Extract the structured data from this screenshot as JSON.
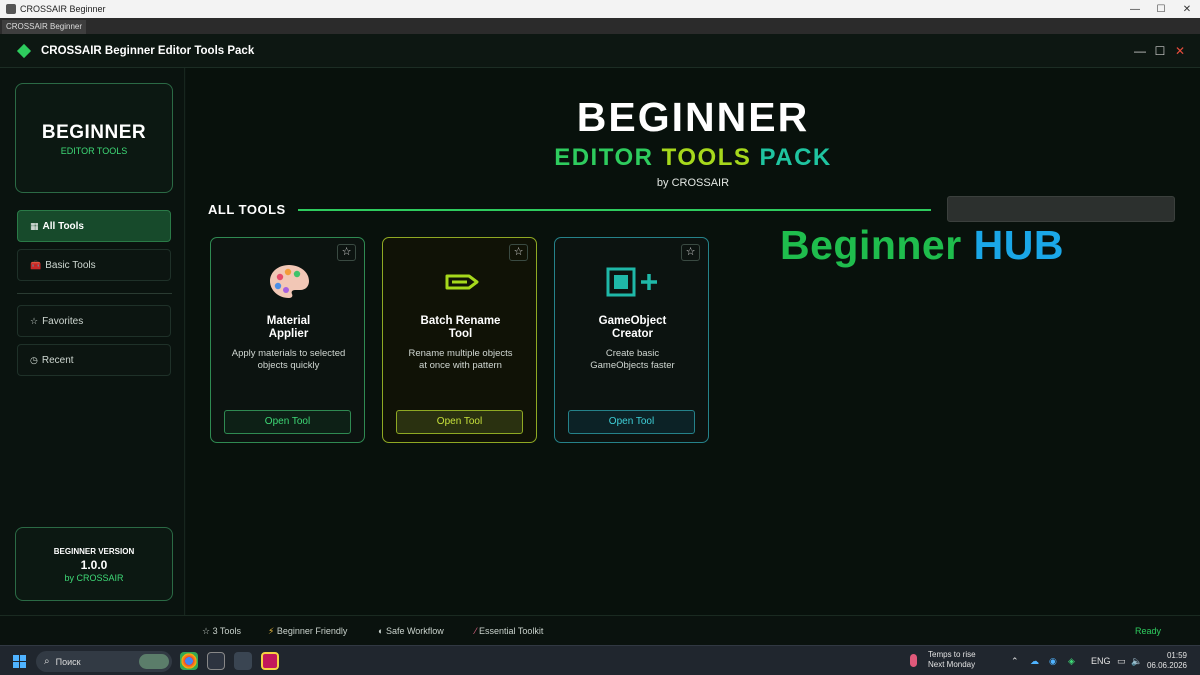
{
  "os_window": {
    "title": "CROSSAIR Beginner",
    "controls": [
      "—",
      "☐",
      "✕"
    ]
  },
  "tab": {
    "label": "CROSSAIR Beginner"
  },
  "app": {
    "title": "CROSSAIR Beginner Editor Tools Pack",
    "brand_color": "#2ecc5e"
  },
  "sidebar": {
    "logo": {
      "title": "BEGINNER",
      "subtitle": "EDITOR TOOLS"
    },
    "items": [
      {
        "icon": "▦",
        "label": "All Tools",
        "active": true
      },
      {
        "icon": "🧰",
        "label": "Basic Tools",
        "active": false
      },
      {
        "icon": "☆",
        "label": "Favorites",
        "active": false
      },
      {
        "icon": "◷",
        "label": "Recent",
        "active": false
      }
    ],
    "version": {
      "label": "BEGINNER VERSION",
      "number": "1.0.0",
      "author": "by CROSSAIR"
    }
  },
  "hero": {
    "title": "BEGINNER",
    "sub_words": [
      "EDITOR",
      "TOOLS",
      "PACK"
    ],
    "byline": "by CROSSAIR"
  },
  "section": {
    "title": "ALL TOOLS",
    "search_placeholder": ""
  },
  "overlay": {
    "word1": "Beginner",
    "word2": "HUB"
  },
  "tools": [
    {
      "name": "Material Applier",
      "description": "Apply materials to selected objects quickly",
      "button": "Open Tool",
      "icon": "palette-icon",
      "accent": "#2f8a52"
    },
    {
      "name": "Batch Rename Tool",
      "description": "Rename multiple objects at once with pattern",
      "button": "Open Tool",
      "icon": "pencil-icon",
      "accent": "#8fa923"
    },
    {
      "name": "GameObject Creator",
      "description": "Create basic GameObjects faster",
      "button": "Open Tool",
      "icon": "add-object-icon",
      "accent": "#25828a"
    }
  ],
  "status": {
    "items": [
      {
        "icon": "☆",
        "label": "3 Tools"
      },
      {
        "icon": "⚡",
        "label": "Beginner Friendly"
      },
      {
        "icon": "◐",
        "label": "Safe Workflow"
      },
      {
        "icon": "⁄",
        "label": "Essential Toolkit"
      }
    ],
    "ready": "Ready"
  },
  "taskbar": {
    "search": "Поиск",
    "weather_title": "Temps to rise",
    "weather_sub": "Next Monday",
    "lang": "ENG",
    "time": "01:59",
    "date": "06.06.2026"
  }
}
